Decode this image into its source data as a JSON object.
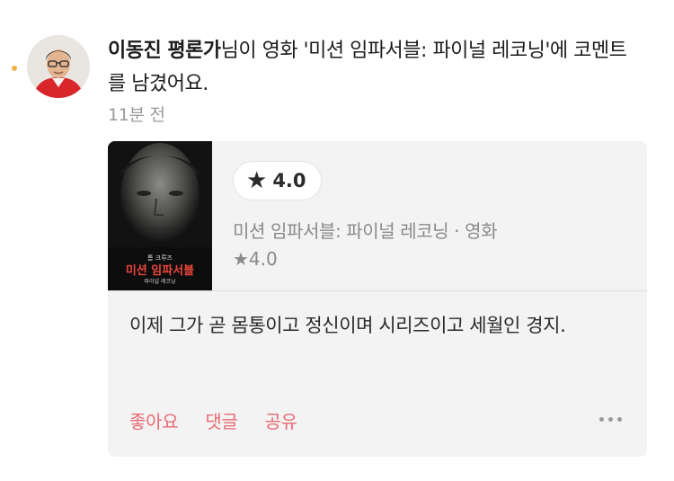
{
  "activity": {
    "author_name": "이동진 평론가",
    "action_text": "님이 영화 '미션 임파서블: 파이널 레코닝'에 코멘트를 남겼어요.",
    "time_ago": "11분 전"
  },
  "card": {
    "poster": {
      "text_top": "톰 크루즈",
      "title": "미션 임파서블",
      "subtitle": "파이널 레코닝"
    },
    "rating_star": "★",
    "rating_value": "4.0",
    "movie_meta": "미션 임파서블: 파이널 레코닝 · 영화",
    "movie_avg": "★4.0",
    "comment": "이제 그가 곧 몸통이고 정신이며 시리즈이고 세월인 경지.",
    "actions": {
      "like": "좋아요",
      "reply": "댓글",
      "share": "공유"
    }
  },
  "colors": {
    "accent": "#e96a73",
    "unread_dot": "#f2b24a",
    "card_bg": "#f3f3f3"
  },
  "icons": {
    "more": "more-horizontal-icon",
    "star": "star-icon"
  }
}
